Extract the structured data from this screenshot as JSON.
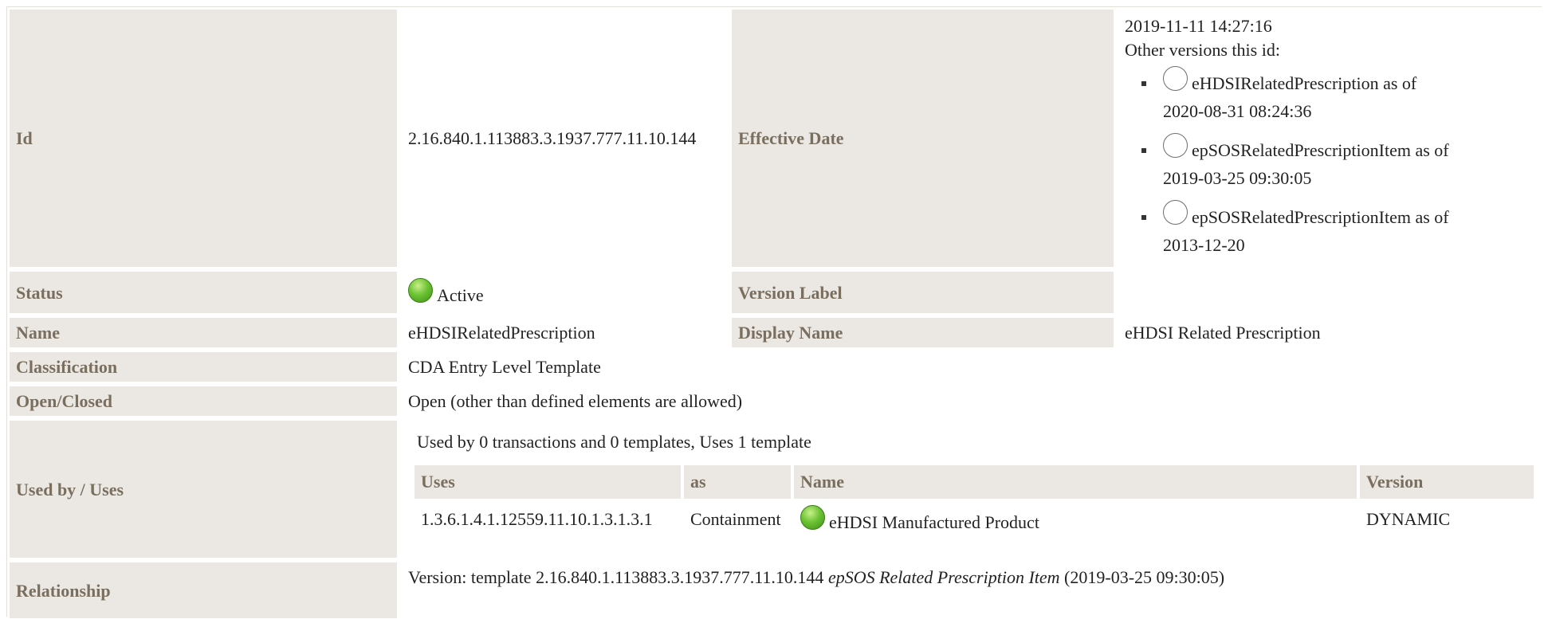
{
  "labels": {
    "id": "Id",
    "effective_date": "Effective Date",
    "status": "Status",
    "version_label": "Version Label",
    "name": "Name",
    "display_name": "Display Name",
    "classification": "Classification",
    "open_closed": "Open/Closed",
    "used_by_uses": "Used by / Uses",
    "relationship": "Relationship"
  },
  "values": {
    "id": "2.16.840.1.113883.3.1937.777.11.10.144",
    "effective_date": "2019-11-11 14:27:16",
    "other_versions_label": "Other versions this id:",
    "other_versions": [
      {
        "name": "eHDSIRelatedPrescription",
        "as_of": "as of",
        "date": "2020-08-31 08:24:36"
      },
      {
        "name": "epSOSRelatedPrescriptionItem",
        "as_of": "as of",
        "date": "2019-03-25 09:30:05"
      },
      {
        "name": "epSOSRelatedPrescriptionItem",
        "as_of": "as of",
        "date": "2013-12-20"
      }
    ],
    "status": "Active",
    "version_label": "",
    "name": "eHDSIRelatedPrescription",
    "display_name": "eHDSI Related Prescription",
    "classification": "CDA Entry Level Template",
    "open_closed": "Open (other than defined elements are allowed)",
    "used_by_summary": "Used by 0 transactions and 0 templates, Uses 1 template",
    "uses_table": {
      "headers": [
        "Uses",
        "as",
        "Name",
        "Version"
      ],
      "rows": [
        {
          "uses": "1.3.6.1.4.1.12559.11.10.1.3.1.3.1",
          "as": "Containment",
          "name": "eHDSI Manufactured Product",
          "version": "DYNAMIC"
        }
      ]
    },
    "relationship": {
      "prefix": "Version: template 2.16.840.1.113883.3.1937.777.11.10.144",
      "template_name": "epSOS Related Prescription Item",
      "date": "(2019-03-25 09:30:05)"
    }
  },
  "colors": {
    "label_bg": "#ebe8e3",
    "label_text": "#7a6e5e",
    "status_active": "#6cc333"
  },
  "icons": {
    "status": "green-status-circle-icon",
    "version": "empty-circle-icon"
  }
}
